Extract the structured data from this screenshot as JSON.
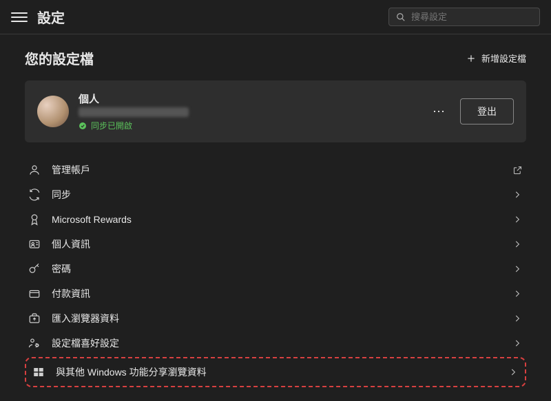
{
  "header": {
    "title": "設定",
    "search_placeholder": "搜尋設定"
  },
  "section": {
    "title": "您的設定檔",
    "add_profile_label": "新增設定檔"
  },
  "profile": {
    "name": "個人",
    "sync_status": "同步已開啟",
    "signout_label": "登出"
  },
  "menu": [
    {
      "id": "manage-account",
      "label": "管理帳戶",
      "trail": "external"
    },
    {
      "id": "sync",
      "label": "同步",
      "trail": "chevron"
    },
    {
      "id": "rewards",
      "label": "Microsoft Rewards",
      "trail": "chevron"
    },
    {
      "id": "personal-info",
      "label": "個人資訊",
      "trail": "chevron"
    },
    {
      "id": "passwords",
      "label": "密碼",
      "trail": "chevron"
    },
    {
      "id": "payment",
      "label": "付款資訊",
      "trail": "chevron"
    },
    {
      "id": "import",
      "label": "匯入瀏覽器資料",
      "trail": "chevron"
    },
    {
      "id": "profile-prefs",
      "label": "設定檔喜好設定",
      "trail": "chevron"
    },
    {
      "id": "share-windows",
      "label": "與其他 Windows 功能分享瀏覽資料",
      "trail": "chevron",
      "highlighted": true
    }
  ]
}
